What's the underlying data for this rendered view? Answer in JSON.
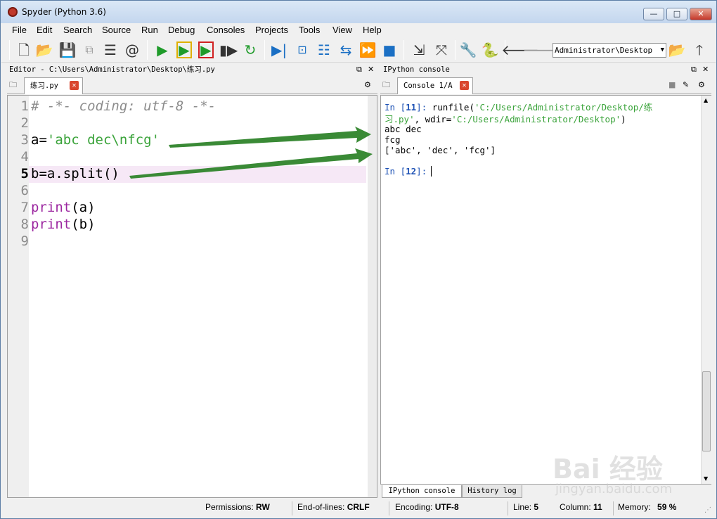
{
  "window": {
    "title": "Spyder (Python 3.6)",
    "min_label": "—",
    "max_label": "□",
    "close_label": "✕"
  },
  "menubar": [
    "File",
    "Edit",
    "Search",
    "Source",
    "Run",
    "Debug",
    "Consoles",
    "Projects",
    "Tools",
    "View",
    "Help"
  ],
  "toolbar": {
    "working_dir": "Administrator\\Desktop"
  },
  "editor_pane": {
    "title": "Editor - C:\\Users\\Administrator\\Desktop\\练习.py",
    "tab_label": "练习.py",
    "lines": [
      {
        "no": "1",
        "text": "# -*- coding: utf-8 -*-"
      },
      {
        "no": "2",
        "text": ""
      },
      {
        "no": "3",
        "text": "a='abc dec\\nfcg'"
      },
      {
        "no": "4",
        "text": ""
      },
      {
        "no": "5",
        "text": "b=a.split()"
      },
      {
        "no": "6",
        "text": ""
      },
      {
        "no": "7",
        "text": "print(a)"
      },
      {
        "no": "8",
        "text": "print(b)"
      },
      {
        "no": "9",
        "text": ""
      }
    ],
    "code": {
      "comment": "# -*- coding: utf-8 -*-",
      "l3_var": "a=",
      "l3_str": "'abc dec\\nfcg'",
      "l5": "b=a.split()",
      "l7_kw": "print",
      "l7_rest": "(a)",
      "l8_kw": "print",
      "l8_rest": "(b)"
    }
  },
  "console_pane": {
    "title": "IPython console",
    "tab_label": "Console 1/A",
    "in11_prompt": "In [",
    "in11_num": "11",
    "in11_close": "]:",
    "in11_code1": " runfile(",
    "in11_str1": "'C:/Users/Administrator/Desktop/练",
    "in11_str1b": "习.py'",
    "in11_code2": ", wdir=",
    "in11_str2": "'C:/Users/Administrator/Desktop'",
    "in11_code3": ")",
    "out1": "abc dec",
    "out2": "fcg",
    "out3": "['abc', 'dec', 'fcg']",
    "in12_prompt": "In [",
    "in12_num": "12",
    "in12_close": "]:",
    "bottom_tabs": [
      "IPython console",
      "History log"
    ]
  },
  "statusbar": {
    "permissions_label": "Permissions:",
    "permissions_value": "RW",
    "eol_label": "End-of-lines:",
    "eol_value": "CRLF",
    "encoding_label": "Encoding:",
    "encoding_value": "UTF-8",
    "line_label": "Line:",
    "line_value": "5",
    "column_label": "Column:",
    "column_value": "11",
    "memory_label": "Memory:",
    "memory_value": "59 %"
  },
  "watermark": {
    "brand": "Bai 经验",
    "url": "jingyan.baidu.com"
  },
  "colors": {
    "arrow": "#3a8a36",
    "string": "#3aa33a",
    "keyword": "#9c27a0",
    "prompt": "#1e52b5"
  }
}
